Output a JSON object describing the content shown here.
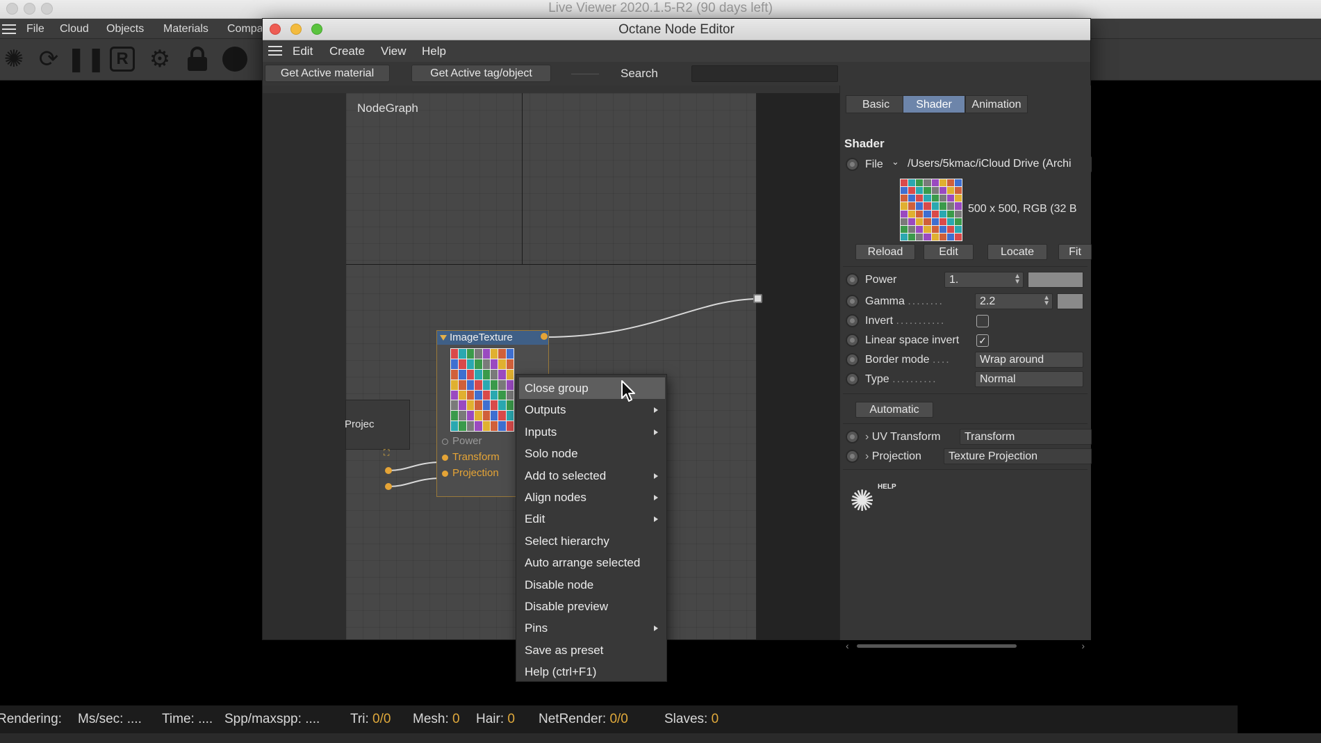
{
  "liveviewer": {
    "title": "Live Viewer 2020.1.5-R2 (90 days left)",
    "menu": [
      "File",
      "Cloud",
      "Objects",
      "Materials",
      "Compa"
    ],
    "toolbar_icons": [
      "octane-logo-icon",
      "refresh-icon",
      "pause-icon",
      "r-icon",
      "gear-icon",
      "lock-icon",
      "sphere-icon"
    ],
    "status": {
      "rendering_label": "Rendering:",
      "mssec_label": "Ms/sec:",
      "mssec_value": "....",
      "time_label": "Time:",
      "time_value": "....",
      "spp_label": "Spp/maxspp:",
      "spp_value": "....",
      "tri_label": "Tri:",
      "tri_value": "0/0",
      "mesh_label": "Mesh:",
      "mesh_value": "0",
      "hair_label": "Hair:",
      "hair_value": "0",
      "netrender_label": "NetRender:",
      "netrender_value": "0/0",
      "slaves_label": "Slaves:",
      "slaves_value": "0"
    }
  },
  "editor": {
    "title": "Octane Node Editor",
    "menu": [
      "Edit",
      "Create",
      "View",
      "Help"
    ],
    "toolbar": {
      "get_active_material": "Get Active material",
      "get_active_tag": "Get Active tag/object",
      "search_label": "Search",
      "search_value": ""
    },
    "graph": {
      "label": "NodeGraph",
      "node_title": "ImageTexture",
      "pins": [
        "Power",
        "Transform",
        "Projection"
      ],
      "proj_node_label": "Projec"
    },
    "panel": {
      "tabs": [
        "Basic",
        "Shader",
        "Animation"
      ],
      "active_tab": "Shader",
      "section": "Shader",
      "file_label": "File",
      "file_path": "/Users/5kmac/iCloud Drive (Archi",
      "image_info": "500 x 500, RGB (32 B",
      "buttons": [
        "Reload",
        "Edit",
        "Locate",
        "Fit"
      ],
      "power_label": "Power",
      "power_value": "1.",
      "gamma_label": "Gamma",
      "gamma_value": "2.2",
      "invert_label": "Invert",
      "linear_label": "Linear space invert",
      "border_label": "Border mode",
      "border_value": "Wrap around",
      "type_label": "Type",
      "type_value": "Normal",
      "automatic": "Automatic",
      "uv_label": "UV Transform",
      "uv_value": "Transform",
      "proj_label": "Projection",
      "proj_value": "Texture Projection",
      "help_label": "HELP"
    }
  },
  "context_menu": {
    "items": [
      {
        "label": "Close group",
        "submenu": false
      },
      {
        "label": "Outputs",
        "submenu": true
      },
      {
        "label": "Inputs",
        "submenu": true
      },
      {
        "label": "Solo node",
        "submenu": false
      },
      {
        "label": "Add to selected",
        "submenu": true
      },
      {
        "label": "Align nodes",
        "submenu": true
      },
      {
        "label": "Edit",
        "submenu": true
      },
      {
        "label": "Select hierarchy",
        "submenu": false
      },
      {
        "label": "Auto arrange selected",
        "submenu": false
      },
      {
        "label": "Disable node",
        "submenu": false
      },
      {
        "label": "Disable preview",
        "submenu": false
      },
      {
        "label": "Pins",
        "submenu": true
      },
      {
        "label": "Save as preset",
        "submenu": false
      },
      {
        "label": "Help (ctrl+F1)",
        "submenu": false
      }
    ],
    "hovered": "Close group"
  },
  "colors": {
    "accent_tab": "#6d85aa",
    "pin_orange": "#e5a436",
    "status_value": "#e0a93b",
    "node_header": "#3f5f86"
  }
}
